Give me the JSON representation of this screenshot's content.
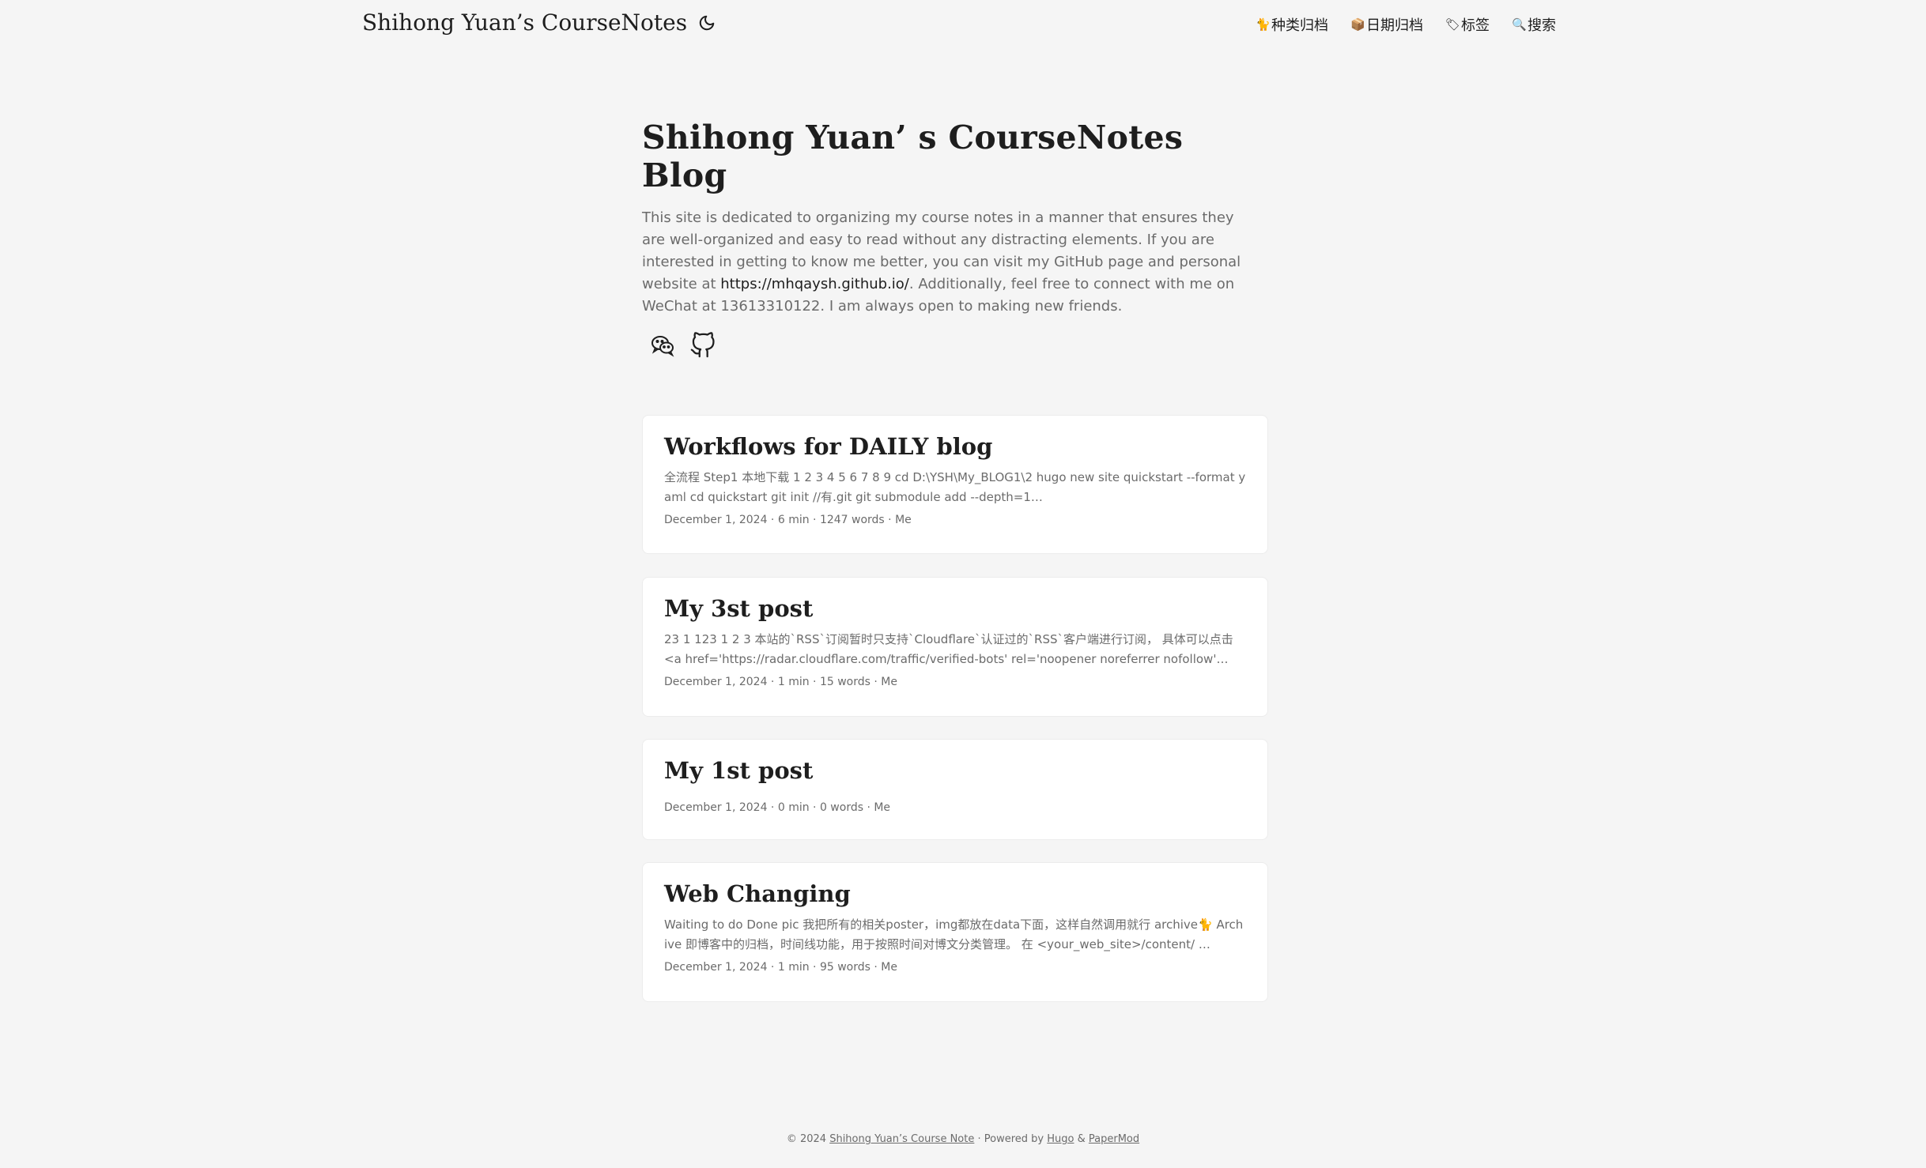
{
  "header": {
    "logo": "Shihong Yuan’s CourseNotes",
    "menu": [
      {
        "icon": "🐈",
        "label": "种类归档"
      },
      {
        "icon": "📦",
        "label": "日期归档"
      },
      {
        "icon": "🏷",
        "label": "标签"
      },
      {
        "icon": "🔍",
        "label": "搜索"
      }
    ]
  },
  "home": {
    "title": "Shihong Yuan’ s CourseNotes Blog",
    "desc_part1": "This site is dedicated to organizing my course notes in a manner that ensures they are well-organized and easy to read without any distracting elements. If you are interested in getting to know me better, you can visit my GitHub page and personal website at ",
    "desc_link": "https://mhqaysh.github.io/",
    "desc_part2": ". Additionally, feel free to connect with me on WeChat at 13613310122. I am always open to making new friends."
  },
  "posts": [
    {
      "title": "Workflows for DAILY blog",
      "excerpt": "全流程 Step1 本地下载 1 2 3 4 5 6 7 8 9 cd D:\\YSH\\My_BLOG1\\2 hugo new site quickstart --format yaml cd quickstart git init //有.git git submodule add --depth=1…",
      "meta": "December 1, 2024 · 6 min · 1247 words · Me"
    },
    {
      "title": "My 3st post",
      "excerpt": "23 1 123 1 2 3 本站的`RSS`订阅暂时只支持`Cloudflare`认证过的`RSS`客户端进行订阅， 具体可以点击 <a href='https://radar.cloudflare.com/traffic/verified-bots' rel='noopener noreferrer nofollow'…",
      "meta": "December 1, 2024 · 1 min · 15 words · Me"
    },
    {
      "title": "My 1st post",
      "excerpt": "",
      "meta": "December 1, 2024 · 0 min · 0 words · Me"
    },
    {
      "title": "Web Changing",
      "excerpt": "Waiting to do Done pic 我把所有的相关poster，img都放在data下面，这样自然调用就行 archive🐈 Archive 即博客中的归档，时间线功能，用于按照时间对博文分类管理。 在 <your_web_site>/content/ …",
      "meta": "December 1, 2024 · 1 min · 95 words · Me"
    }
  ],
  "footer": {
    "copy": "© 2024 ",
    "site": "Shihong Yuan’s Course Note",
    "powered": " · Powered by ",
    "hugo": "Hugo",
    "amp": " & ",
    "papermod": "PaperMod"
  }
}
